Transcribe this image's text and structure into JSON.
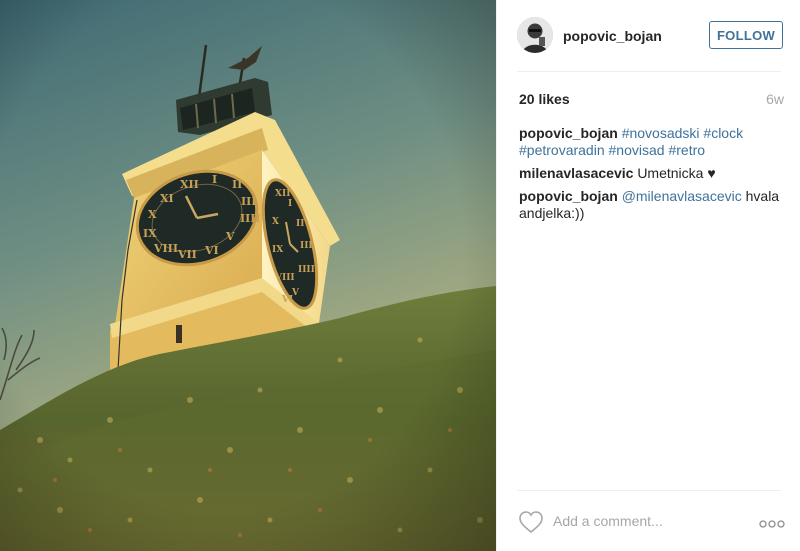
{
  "post": {
    "username": "popovic_bojan",
    "follow_label": "FOLLOW",
    "likes": "20 likes",
    "age": "6w",
    "comments": [
      {
        "user": "popovic_bojan",
        "parts": [
          {
            "type": "tag",
            "text": "#novosadski"
          },
          {
            "type": "tag",
            "text": "#clock"
          },
          {
            "type": "tag",
            "text": "#petrovaradin"
          },
          {
            "type": "tag",
            "text": "#novisad"
          },
          {
            "type": "tag",
            "text": "#retro"
          }
        ]
      },
      {
        "user": "milenavlasacevic",
        "parts": [
          {
            "type": "text",
            "text": "Umetnicka ♥"
          }
        ]
      },
      {
        "user": "popovic_bojan",
        "parts": [
          {
            "type": "tag",
            "text": "@milenavlasacevic"
          },
          {
            "type": "text",
            "text": "hvala andjelka:))"
          }
        ]
      }
    ],
    "add_comment_placeholder": "Add a comment...",
    "icons": {
      "like": "heart-outline-icon",
      "more": "ellipsis-icon"
    },
    "colors": {
      "link": "#3f729b",
      "text": "#262626",
      "muted": "#a5a7aa",
      "divider": "#efefef"
    }
  }
}
